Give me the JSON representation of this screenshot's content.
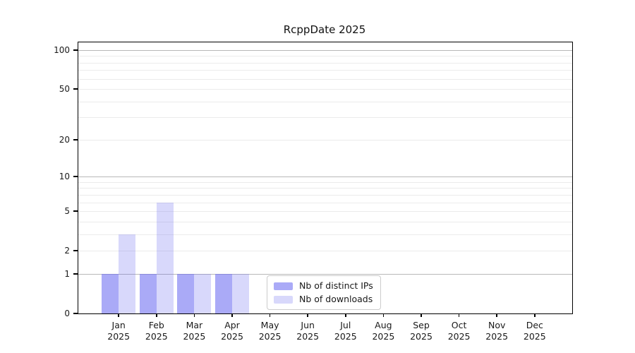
{
  "title": "RcppDate 2025",
  "colors": {
    "bar_ips": "rgba(100,100,240,0.55)",
    "bar_downloads": "rgba(100,100,240,0.25)",
    "grid_major": "#b8b8b8",
    "grid_minor": "#ebebeb",
    "spine": "#000000"
  },
  "legend": {
    "items": [
      {
        "label": "Nb of distinct IPs"
      },
      {
        "label": "Nb of downloads"
      }
    ]
  },
  "chart_data": {
    "type": "bar",
    "title": "RcppDate 2025",
    "categories": [
      "Jan 2025",
      "Feb 2025",
      "Mar 2025",
      "Apr 2025",
      "May 2025",
      "Jun 2025",
      "Jul 2025",
      "Aug 2025",
      "Sep 2025",
      "Oct 2025",
      "Nov 2025",
      "Dec 2025"
    ],
    "series": [
      {
        "name": "Nb of distinct IPs",
        "values": [
          1,
          1,
          1,
          1,
          0,
          0,
          0,
          0,
          0,
          0,
          0,
          0
        ]
      },
      {
        "name": "Nb of downloads",
        "values": [
          3,
          6,
          1,
          1,
          0,
          0,
          0,
          0,
          0,
          0,
          0,
          0
        ]
      }
    ],
    "xlabel": "",
    "ylabel": "",
    "yscale": "log1p",
    "ylim": [
      0,
      100
    ],
    "y_ticks": [
      0,
      1,
      2,
      5,
      10,
      20,
      50,
      100
    ],
    "grid_major_values": [
      1,
      10,
      100
    ],
    "grid_minor_values": [
      2,
      3,
      4,
      5,
      6,
      7,
      8,
      9,
      20,
      30,
      40,
      50,
      60,
      70,
      80,
      90
    ],
    "grid": "horizontal",
    "legend_position": "lower center-left"
  }
}
